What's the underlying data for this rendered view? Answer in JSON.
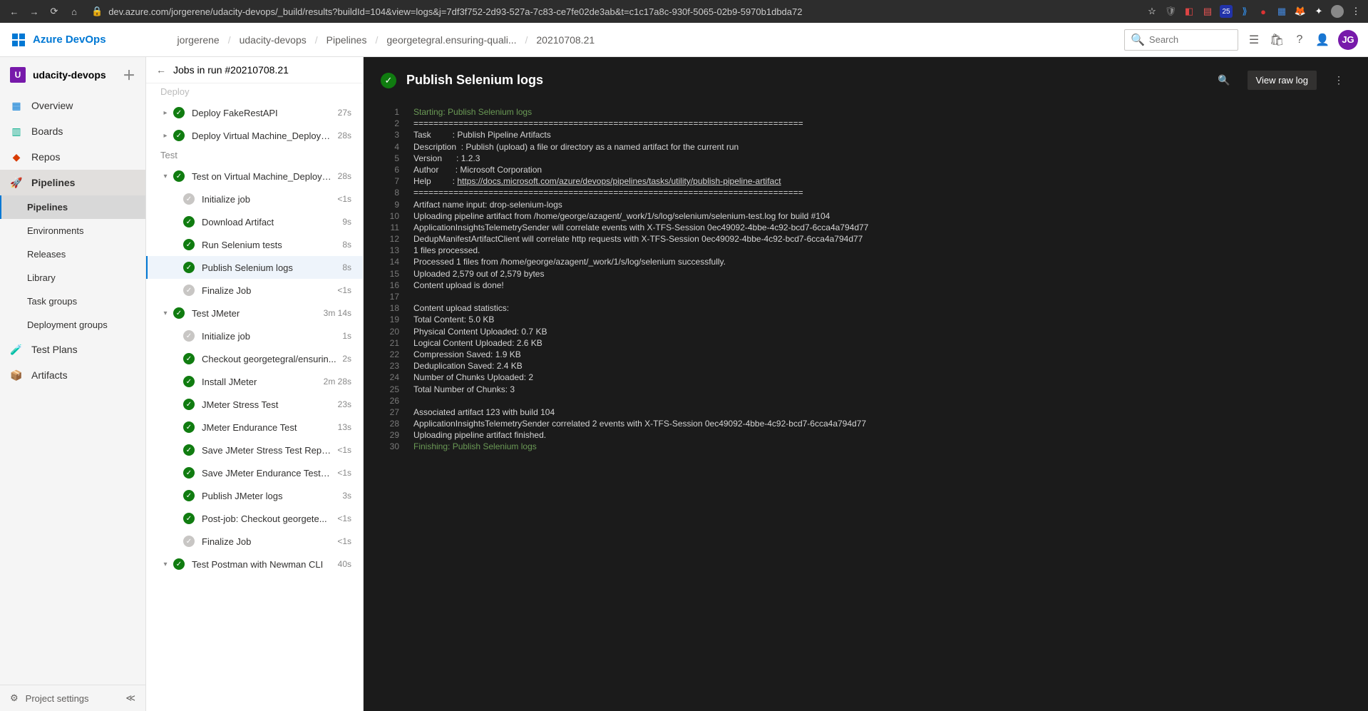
{
  "browser": {
    "url": "dev.azure.com/jorgerene/udacity-devops/_build/results?buildId=104&view=logs&j=7df3f752-2d93-527a-7c83-ce7fe02de3ab&t=c1c17a8c-930f-5065-02b9-5970b1dbda72"
  },
  "brand": "Azure DevOps",
  "breadcrumb": [
    "jorgerene",
    "udacity-devops",
    "Pipelines",
    "georgetegral.ensuring-quali...",
    "20210708.21"
  ],
  "search_placeholder": "Search",
  "user_initials": "JG",
  "project": {
    "name": "udacity-devops",
    "badge": "U"
  },
  "nav": {
    "overview": "Overview",
    "boards": "Boards",
    "repos": "Repos",
    "pipelines": "Pipelines",
    "pipelines_sub": "Pipelines",
    "environments": "Environments",
    "releases": "Releases",
    "library": "Library",
    "task_groups": "Task groups",
    "deployment_groups": "Deployment groups",
    "test_plans": "Test Plans",
    "artifacts": "Artifacts",
    "project_settings": "Project settings"
  },
  "jobs": {
    "header": "Jobs in run #20210708.21",
    "stage_deploy": "Deploy",
    "stage_test": "Test",
    "items": [
      {
        "label": "Deploy FakeRestAPI",
        "dur": "27s"
      },
      {
        "label": "Deploy Virtual Machine_Deploy_...",
        "dur": "28s"
      },
      {
        "label": "Test on Virtual Machine_Deploy_...",
        "dur": "28s"
      },
      {
        "label": "Initialize job",
        "dur": "<1s"
      },
      {
        "label": "Download Artifact",
        "dur": "9s"
      },
      {
        "label": "Run Selenium tests",
        "dur": "8s"
      },
      {
        "label": "Publish Selenium logs",
        "dur": "8s"
      },
      {
        "label": "Finalize Job",
        "dur": "<1s"
      },
      {
        "label": "Test JMeter",
        "dur": "3m 14s"
      },
      {
        "label": "Initialize job",
        "dur": "1s"
      },
      {
        "label": "Checkout georgetegral/ensurin...",
        "dur": "2s"
      },
      {
        "label": "Install JMeter",
        "dur": "2m 28s"
      },
      {
        "label": "JMeter Stress Test",
        "dur": "23s"
      },
      {
        "label": "JMeter Endurance Test",
        "dur": "13s"
      },
      {
        "label": "Save JMeter Stress Test Repor...",
        "dur": "<1s"
      },
      {
        "label": "Save JMeter Endurance Test R...",
        "dur": "<1s"
      },
      {
        "label": "Publish JMeter logs",
        "dur": "3s"
      },
      {
        "label": "Post-job: Checkout georgete...",
        "dur": "<1s"
      },
      {
        "label": "Finalize Job",
        "dur": "<1s"
      },
      {
        "label": "Test Postman with Newman CLI",
        "dur": "40s"
      }
    ]
  },
  "log": {
    "title": "Publish Selenium logs",
    "view_raw": "View raw log",
    "lines": [
      {
        "n": 1,
        "t": "Starting: Publish Selenium logs",
        "c": "g"
      },
      {
        "n": 2,
        "t": "=============================================================================="
      },
      {
        "n": 3,
        "t": "Task         : Publish Pipeline Artifacts"
      },
      {
        "n": 4,
        "t": "Description  : Publish (upload) a file or directory as a named artifact for the current run"
      },
      {
        "n": 5,
        "t": "Version      : 1.2.3"
      },
      {
        "n": 6,
        "t": "Author       : Microsoft Corporation"
      },
      {
        "n": 7,
        "t": "Help         : ",
        "link": "https://docs.microsoft.com/azure/devops/pipelines/tasks/utility/publish-pipeline-artifact"
      },
      {
        "n": 8,
        "t": "=============================================================================="
      },
      {
        "n": 9,
        "t": "Artifact name input: drop-selenium-logs"
      },
      {
        "n": 10,
        "t": "Uploading pipeline artifact from /home/george/azagent/_work/1/s/log/selenium/selenium-test.log for build #104"
      },
      {
        "n": 11,
        "t": "ApplicationInsightsTelemetrySender will correlate events with X-TFS-Session 0ec49092-4bbe-4c92-bcd7-6cca4a794d77"
      },
      {
        "n": 12,
        "t": "DedupManifestArtifactClient will correlate http requests with X-TFS-Session 0ec49092-4bbe-4c92-bcd7-6cca4a794d77"
      },
      {
        "n": 13,
        "t": "1 files processed."
      },
      {
        "n": 14,
        "t": "Processed 1 files from /home/george/azagent/_work/1/s/log/selenium successfully."
      },
      {
        "n": 15,
        "t": "Uploaded 2,579 out of 2,579 bytes"
      },
      {
        "n": 16,
        "t": "Content upload is done!"
      },
      {
        "n": 17,
        "t": ""
      },
      {
        "n": 18,
        "t": "Content upload statistics:"
      },
      {
        "n": 19,
        "t": "Total Content: 5.0 KB"
      },
      {
        "n": 20,
        "t": "Physical Content Uploaded: 0.7 KB"
      },
      {
        "n": 21,
        "t": "Logical Content Uploaded: 2.6 KB"
      },
      {
        "n": 22,
        "t": "Compression Saved: 1.9 KB"
      },
      {
        "n": 23,
        "t": "Deduplication Saved: 2.4 KB"
      },
      {
        "n": 24,
        "t": "Number of Chunks Uploaded: 2"
      },
      {
        "n": 25,
        "t": "Total Number of Chunks: 3"
      },
      {
        "n": 26,
        "t": ""
      },
      {
        "n": 27,
        "t": "Associated artifact 123 with build 104"
      },
      {
        "n": 28,
        "t": "ApplicationInsightsTelemetrySender correlated 2 events with X-TFS-Session 0ec49092-4bbe-4c92-bcd7-6cca4a794d77"
      },
      {
        "n": 29,
        "t": "Uploading pipeline artifact finished."
      },
      {
        "n": 30,
        "t": "Finishing: Publish Selenium logs",
        "c": "g"
      }
    ]
  }
}
